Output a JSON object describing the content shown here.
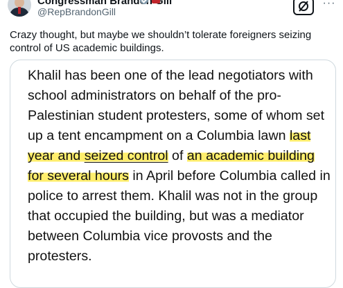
{
  "author": {
    "display_name": "Congressman Brandon Gill",
    "handle": "@RepBrandonGill",
    "avatar_icon": "person-avatar",
    "verified_icon": "verified-badge-icon",
    "affiliation_icon": "flag-badge-icon"
  },
  "toolbar": {
    "grok_icon": "grok-icon",
    "more_label": "···"
  },
  "tweet": {
    "text": "Crazy thought, but maybe we shouldn’t tolerate foreigners seizing control of US academic buildings."
  },
  "article_excerpt": {
    "before_highlight": "Khalil has been one of the lead negotiators with school administrators on behalf of the pro-Palestinian student protesters, some of whom set up a tent encampment on a Columbia lawn ",
    "highlight_1": "last year and ",
    "highlight_underlined": "seized control",
    "between": " of ",
    "highlight_2": "an academic building for several hours",
    "after_highlight": " in April before Columbia called in police to arrest them. Khalil was not in the group that occupied the building, but was a mediator between Columbia vice provosts and the protesters."
  },
  "colors": {
    "text_primary": "#0f1419",
    "text_secondary": "#536471",
    "card_border": "#cfd9de",
    "highlight": "#ffe93c"
  }
}
